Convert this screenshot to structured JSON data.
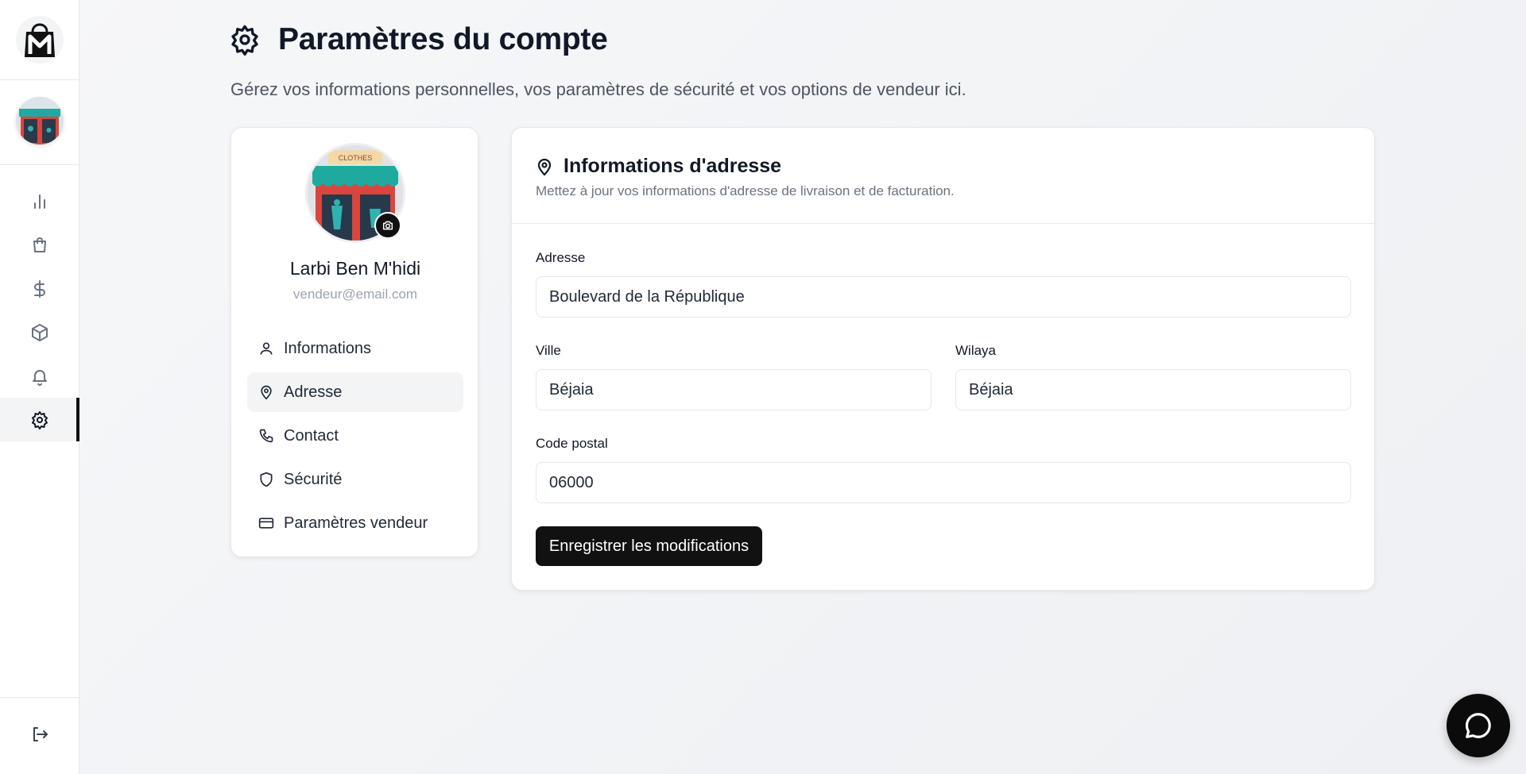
{
  "app": {
    "logo_icon": "shopping-bag-m-logo-icon"
  },
  "sidebar": {
    "items": [
      {
        "icon": "bar-chart-icon",
        "name": "nav-analytics"
      },
      {
        "icon": "shopping-bag-icon",
        "name": "nav-orders"
      },
      {
        "icon": "dollar-icon",
        "name": "nav-finances"
      },
      {
        "icon": "package-icon",
        "name": "nav-products"
      },
      {
        "icon": "bell-icon",
        "name": "nav-notifications"
      },
      {
        "icon": "settings-icon",
        "name": "nav-settings",
        "active": true
      }
    ],
    "logout_icon": "logout-icon"
  },
  "header": {
    "title": "Paramètres du compte",
    "subtitle": "Gérez vos informations personnelles, vos paramètres de sécurité et vos options de vendeur ici."
  },
  "profile": {
    "name": "Larbi Ben M'hidi",
    "email": "vendeur@email.com",
    "shop_sign": "CLOTHES",
    "menu": [
      {
        "label": "Informations",
        "icon": "user-icon"
      },
      {
        "label": "Adresse",
        "icon": "map-pin-icon",
        "active": true
      },
      {
        "label": "Contact",
        "icon": "phone-icon"
      },
      {
        "label": "Sécurité",
        "icon": "shield-icon"
      },
      {
        "label": "Paramètres vendeur",
        "icon": "credit-card-icon"
      }
    ]
  },
  "address": {
    "title": "Informations d'adresse",
    "description": "Mettez à jour vos informations d'adresse de livraison et de facturation.",
    "fields": {
      "adresse": {
        "label": "Adresse",
        "value": "Boulevard de la République"
      },
      "ville": {
        "label": "Ville",
        "value": "Béjaia"
      },
      "wilaya": {
        "label": "Wilaya",
        "value": "Béjaia"
      },
      "code_postal": {
        "label": "Code postal",
        "value": "06000"
      }
    },
    "save_label": "Enregistrer les modifications"
  },
  "colors": {
    "accent": "#111111",
    "background": "#f3f4f6",
    "card": "#ffffff",
    "muted_text": "#6b7280"
  }
}
